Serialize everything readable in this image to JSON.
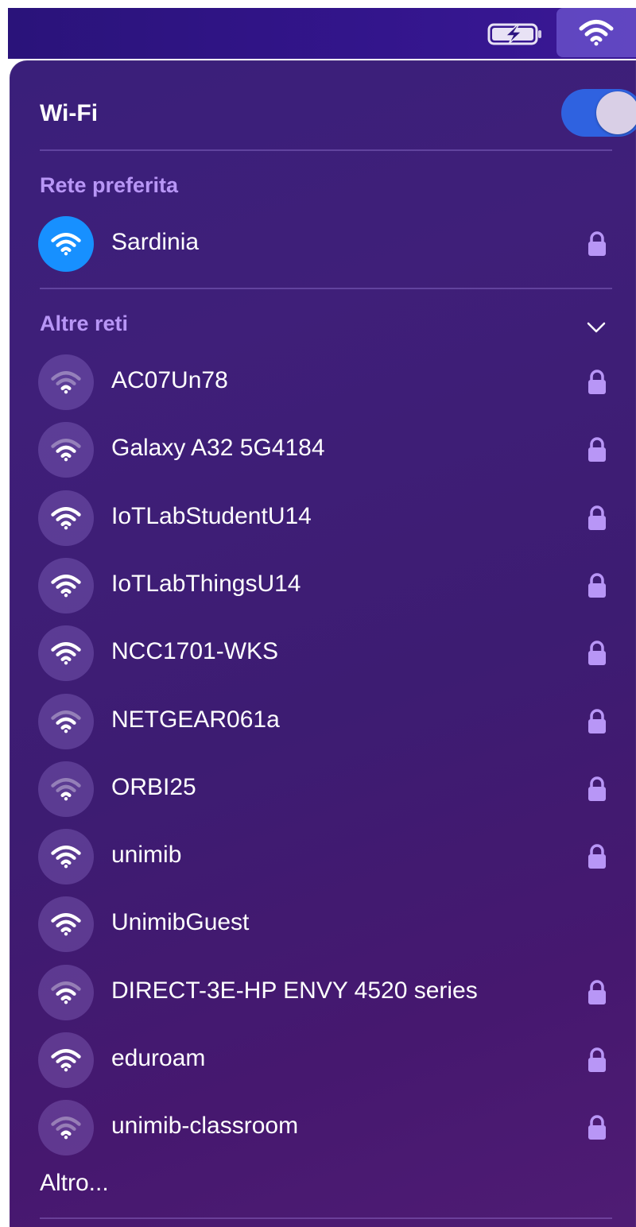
{
  "menubar": {
    "battery_icon": "battery-charging-icon",
    "wifi_icon": "wifi-icon"
  },
  "wifi": {
    "title": "Wi-Fi",
    "enabled": true,
    "accent_color": "#2f62e0"
  },
  "preferred": {
    "section_title": "Rete preferita",
    "network": {
      "name": "Sardinia",
      "secured": true,
      "signal": 3,
      "connected": true
    }
  },
  "others": {
    "section_title": "Altre reti",
    "expanded": true,
    "networks": [
      {
        "name": "AC07Un78",
        "secured": true,
        "signal": 1
      },
      {
        "name": "Galaxy A32 5G4184",
        "secured": true,
        "signal": 2
      },
      {
        "name": "IoTLabStudentU14",
        "secured": true,
        "signal": 3
      },
      {
        "name": "IoTLabThingsU14",
        "secured": true,
        "signal": 3
      },
      {
        "name": "NCC1701-WKS",
        "secured": true,
        "signal": 3
      },
      {
        "name": "NETGEAR061a",
        "secured": true,
        "signal": 2
      },
      {
        "name": "ORBI25",
        "secured": true,
        "signal": 1
      },
      {
        "name": "unimib",
        "secured": true,
        "signal": 3
      },
      {
        "name": "UnimibGuest",
        "secured": false,
        "signal": 3
      },
      {
        "name": "DIRECT-3E-HP ENVY 4520 series",
        "secured": true,
        "signal": 2
      },
      {
        "name": "eduroam",
        "secured": true,
        "signal": 3
      },
      {
        "name": "unimib-classroom",
        "secured": true,
        "signal": 1
      }
    ]
  },
  "footer": {
    "other_label": "Altro..."
  }
}
